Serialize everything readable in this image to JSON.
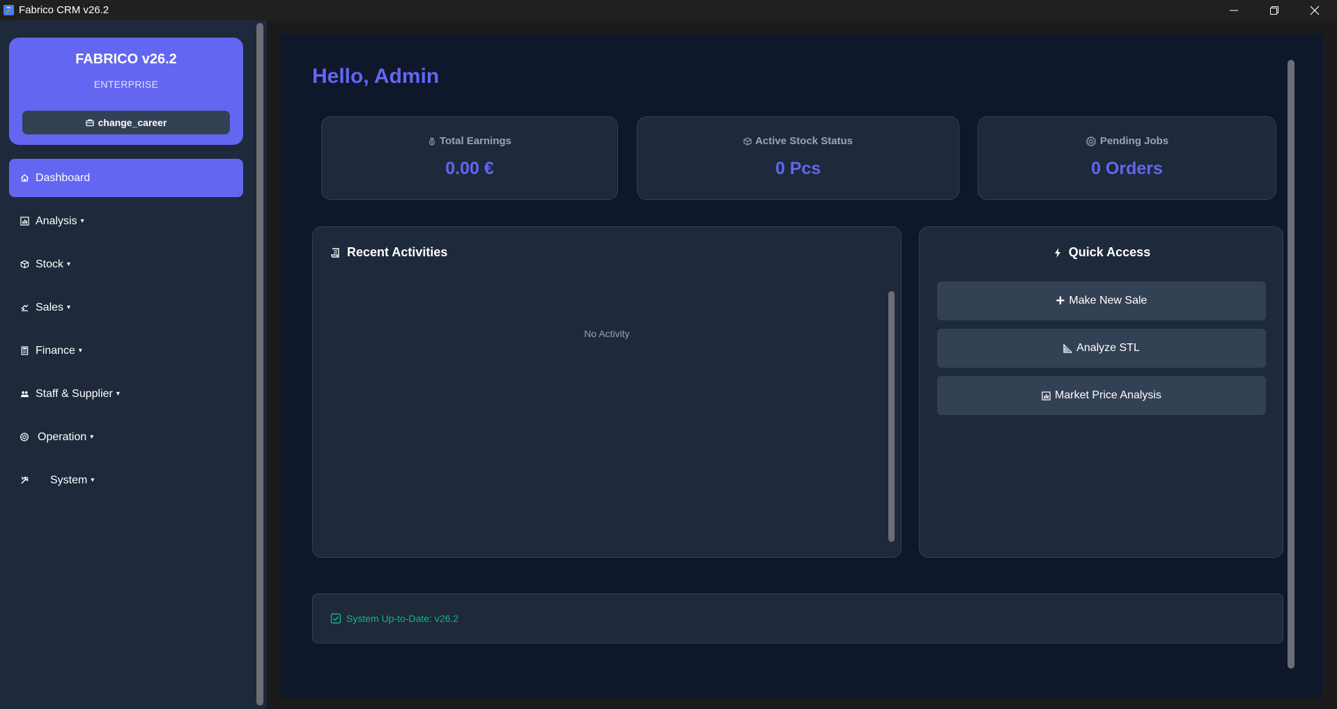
{
  "window": {
    "title": "Fabrico CRM v26.2",
    "app_icon": "fabrico-logo-icon",
    "controls": [
      "minimize-icon",
      "restore-icon",
      "close-icon"
    ]
  },
  "sidebar": {
    "brand_title": "FABRICO v26.2",
    "brand_subtitle": "ENTERPRISE",
    "career_button": {
      "label": "change_career",
      "icon": "briefcase-icon"
    },
    "items": [
      {
        "label": "Dashboard",
        "icon": "home-icon",
        "active": true,
        "caret": ""
      },
      {
        "label": "Analysis",
        "icon": "bar-chart-icon",
        "caret": "▾"
      },
      {
        "label": "Stock",
        "icon": "box-icon",
        "caret": "▾"
      },
      {
        "label": "Sales",
        "icon": "sales-icon",
        "caret": "▾"
      },
      {
        "label": "Finance",
        "icon": "finance-icon",
        "caret": "▾"
      },
      {
        "label": "Staff & Supplier",
        "icon": "users-icon",
        "caret": "▾"
      },
      {
        "label": "Operation",
        "icon": "gear-icon",
        "caret": "▾"
      },
      {
        "label": "System",
        "icon": "tools-icon",
        "caret": "▾"
      }
    ]
  },
  "main": {
    "greeting": "Hello, Admin",
    "stats": [
      {
        "label": "Total Earnings",
        "value": "0.00 €",
        "icon": "money-bag-icon"
      },
      {
        "label": "Active Stock Status",
        "value": "0 Pcs",
        "icon": "box-icon"
      },
      {
        "label": "Pending Jobs",
        "value": "0 Orders",
        "icon": "gear-icon"
      }
    ],
    "recent_activities": {
      "title": "Recent Activities",
      "icon": "scroll-icon",
      "empty_text": "No Activity"
    },
    "quick_access": {
      "title": "Quick Access",
      "icon": "lightning-icon",
      "buttons": [
        {
          "label": "Make New Sale",
          "icon": "plus-icon"
        },
        {
          "label": "Analyze STL",
          "icon": "triangle-ruler-icon"
        },
        {
          "label": "Market Price Analysis",
          "icon": "bar-chart-icon"
        }
      ]
    },
    "status": {
      "text": "System Up-to-Date: v26.2",
      "icon": "check-box-icon",
      "color": "#10b981"
    }
  },
  "colors": {
    "accent": "#6366f1",
    "sidebar_bg": "#1e293b",
    "main_bg": "#0f172a",
    "card_bg": "#1e293b",
    "button_bg": "#334155",
    "success": "#10b981"
  }
}
